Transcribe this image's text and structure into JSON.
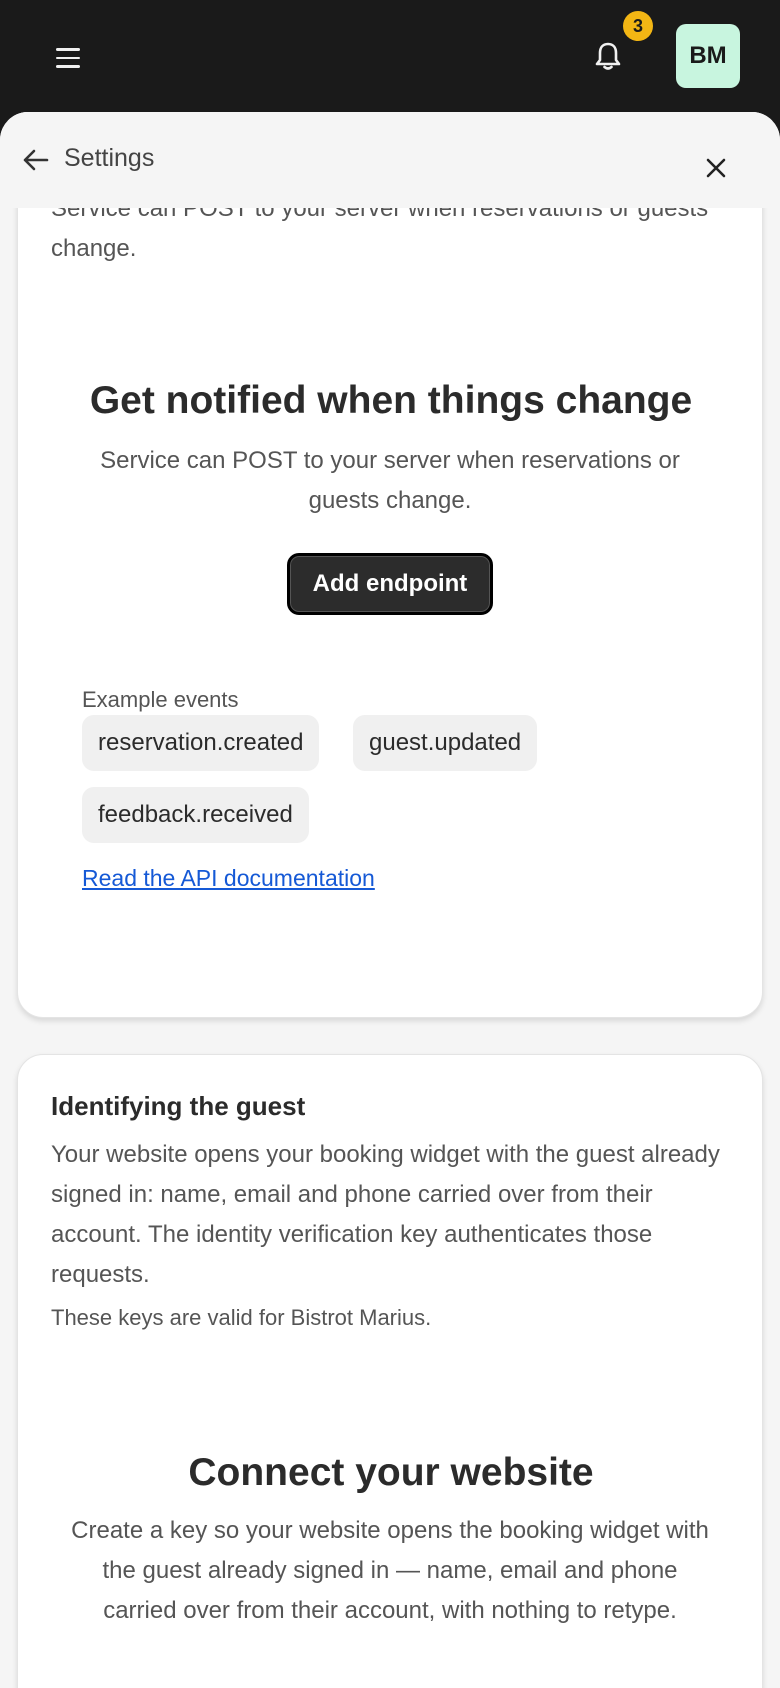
{
  "topbar": {
    "menu_icon": "hamburger-menu-icon",
    "bell_icon": "bell-icon",
    "notification_count": "3",
    "avatar_initials": "BM",
    "colors": {
      "background": "#1a1a1a",
      "badge": "#f3b614",
      "avatar": "#c8f5df"
    }
  },
  "sheet": {
    "title": "Settings",
    "back_icon": "arrow-left-icon",
    "close_icon": "close-icon"
  },
  "webhooks": {
    "intro": "Service can POST to your server when reservations or guests change.",
    "empty_title": "Get notified when things change",
    "empty_desc": "Service can POST to your server when reservations or guests change.",
    "add_button": "Add endpoint",
    "events_label": "Example events",
    "events": [
      "reservation.created",
      "guest.updated",
      "feedback.received"
    ],
    "docs_link": "Read the API documentation"
  },
  "identity": {
    "title": "Identifying the guest",
    "intro": "Your website opens your booking widget with the guest already signed in: name, email and phone carried over from their account. The identity verification key authenticates those requests.",
    "key_note": "These keys are valid for Bistrot Marius.",
    "empty_title": "Connect your website",
    "empty_desc": "Create a key so your website opens the booking widget with the guest already signed in — name, email and phone carried over from their account, with nothing to retype."
  }
}
